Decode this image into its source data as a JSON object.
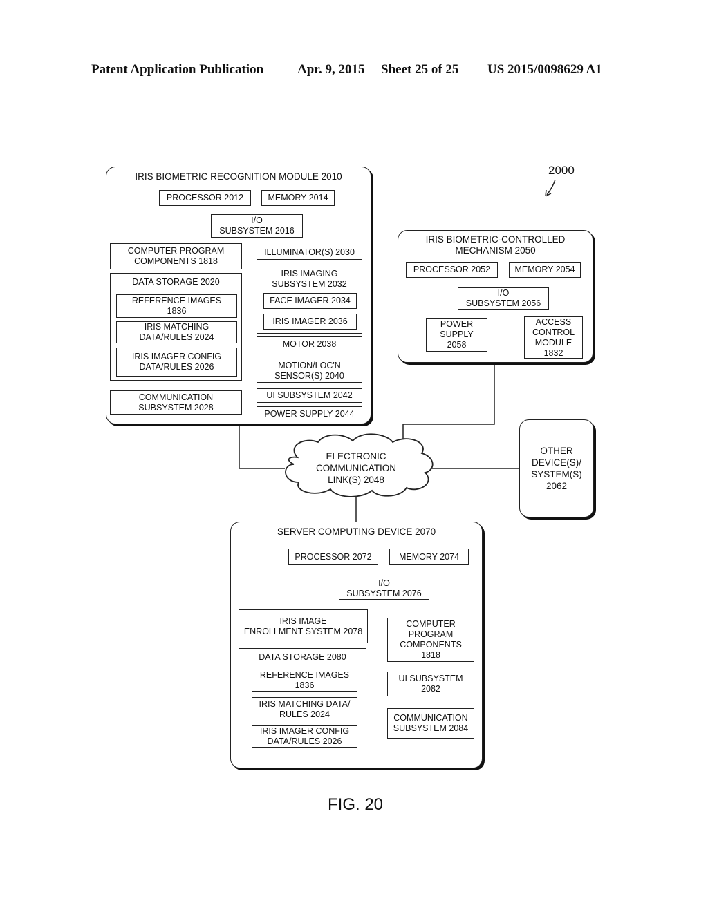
{
  "header": {
    "publication": "Patent Application Publication",
    "date": "Apr. 9, 2015",
    "sheet": "Sheet 25 of 25",
    "number": "US 2015/0098629 A1"
  },
  "ref_number": "2000",
  "figure_label": "FIG. 20",
  "module_2010": {
    "title": "IRIS BIOMETRIC RECOGNITION MODULE 2010",
    "processor": "PROCESSOR 2012",
    "memory": "MEMORY 2014",
    "io": "I/O\nSUBSYSTEM 2016",
    "program_components": "COMPUTER PROGRAM\nCOMPONENTS 1818",
    "data_storage": "DATA STORAGE 2020",
    "reference_images": "REFERENCE IMAGES\n1836",
    "matching_rules": "IRIS MATCHING\nDATA/RULES 2024",
    "imager_config": "IRIS IMAGER CONFIG\nDATA/RULES 2026",
    "communication": "COMMUNICATION\nSUBSYSTEM 2028",
    "illuminators": "ILLUMINATOR(S) 2030",
    "imaging_subsystem": "IRIS IMAGING\nSUBSYSTEM 2032",
    "face_imager": "FACE IMAGER 2034",
    "iris_imager": "IRIS IMAGER 2036",
    "motor": "MOTOR 2038",
    "sensors": "MOTION/LOC'N\nSENSOR(S) 2040",
    "ui": "UI SUBSYSTEM 2042",
    "power": "POWER SUPPLY 2044"
  },
  "mechanism_2050": {
    "title": "IRIS BIOMETRIC-CONTROLLED\nMECHANISM 2050",
    "processor": "PROCESSOR 2052",
    "memory": "MEMORY 2054",
    "io": "I/O\nSUBSYSTEM 2056",
    "power": "POWER\nSUPPLY\n2058",
    "access_control": "ACCESS\nCONTROL\nMODULE\n1832"
  },
  "network": {
    "label": "ELECTRONIC\nCOMMUNICATION\nLINK(S) 2048"
  },
  "other_devices": {
    "label": "OTHER\nDEVICE(S)/\nSYSTEM(S)\n2062"
  },
  "server_2070": {
    "title": "SERVER COMPUTING DEVICE 2070",
    "processor": "PROCESSOR 2072",
    "memory": "MEMORY 2074",
    "io": "I/O\nSUBSYSTEM 2076",
    "enrollment": "IRIS IMAGE\nENROLLMENT SYSTEM 2078",
    "data_storage": "DATA STORAGE 2080",
    "reference_images": "REFERENCE IMAGES\n1836",
    "matching_rules": "IRIS MATCHING DATA/\nRULES 2024",
    "imager_config": "IRIS IMAGER CONFIG\nDATA/RULES 2026",
    "program_components": "COMPUTER\nPROGRAM\nCOMPONENTS\n1818",
    "ui": "UI SUBSYSTEM\n2082",
    "communication": "COMMUNICATION\nSUBSYSTEM 2084"
  }
}
